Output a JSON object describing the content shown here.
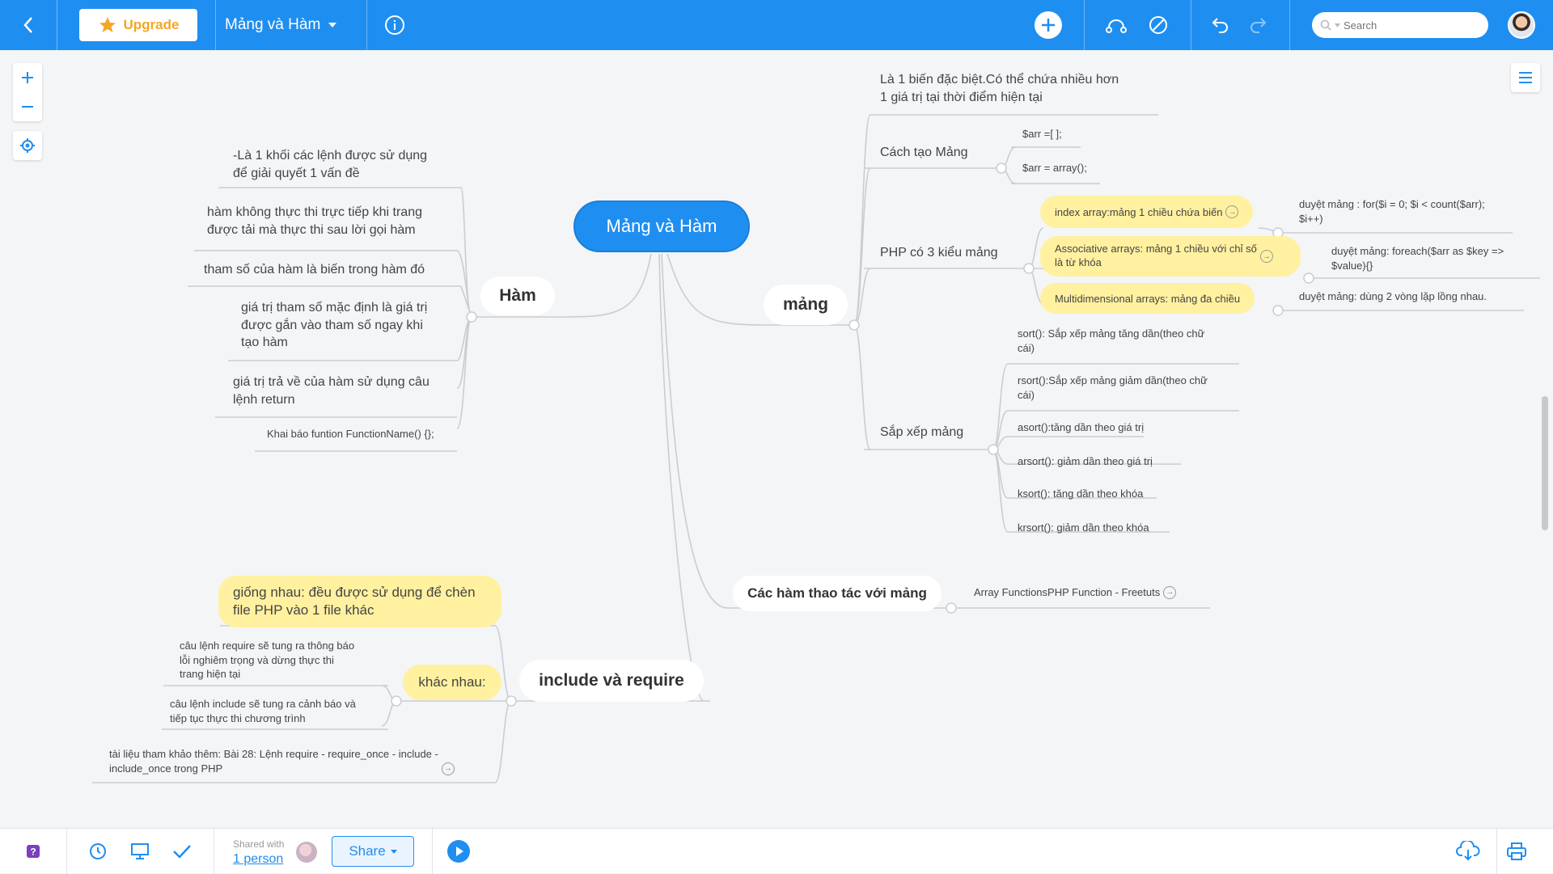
{
  "topbar": {
    "upgrade_label": "Upgrade",
    "title": "Mảng và Hàm",
    "search_placeholder": "Search"
  },
  "bottombar": {
    "shared_with_label": "Shared with",
    "shared_with_count": "1 person",
    "share_label": "Share"
  },
  "mindmap": {
    "root": "Mảng và Hàm",
    "ham": {
      "label": "Hàm",
      "items": [
        "-Là 1 khối các lệnh được sử dụng\nđể giải quyết 1 vấn đề",
        "hàm không thực thi trực tiếp khi trang\nđược tải mà thực thi sau lời gọi hàm",
        "tham số của hàm là biến trong hàm đó",
        "giá trị tham số mặc định là giá trị\nđược gắn vào tham số ngay khi\ntạo hàm",
        "giá trị trả về của hàm sử dụng câu\nlệnh return",
        "Khai báo funtion FunctionName() {};"
      ]
    },
    "mang": {
      "label": "mảng",
      "definition": "Là 1 biến đặc biệt.Có thể chứa nhiều hơn\n1 giá trị tại thời điểm hiện tại",
      "cach_tao": {
        "label": "Cách tạo Mảng",
        "items": [
          "$arr =[ ];",
          "$arr = array();"
        ]
      },
      "kieu_mang": {
        "label": "PHP có 3 kiểu mảng",
        "types": [
          {
            "label": "index array:mảng 1 chiều chứa biến",
            "note": "duyệt mảng : for($i = 0; $i < count($arr);\n$i++)"
          },
          {
            "label": "Associative arrays: mảng 1 chiều với chỉ số\nlà từ  khóa",
            "note": "duyệt mảng: foreach($arr as $key =>\n$value){}"
          },
          {
            "label": "Multidimensional arrays: mảng đa chiều",
            "note": "duyệt mảng: dùng 2 vòng lặp lồng nhau."
          }
        ]
      },
      "sap_xep": {
        "label": "Sắp xếp mảng",
        "items": [
          "sort(): Sắp xếp mảng tăng dần(theo chữ\ncái)",
          "rsort():Sắp xếp mảng giảm dần(theo chữ\ncái)",
          "asort():tăng dần theo giá trị",
          "arsort(): giảm dần theo giá trị",
          "ksort(): tăng dần theo khóa",
          "krsort(): giảm dần theo khóa"
        ]
      }
    },
    "ham_thao_tac": {
      "label": "Các hàm thao tác với mảng",
      "link": "Array FunctionsPHP Function - Freetuts"
    },
    "include": {
      "label": "include và require",
      "giong_nhau": "giống nhau: đều được sử dụng để chèn\nfile PHP vào 1 file khác",
      "khac_nhau": {
        "label": "khác nhau:",
        "items": [
          "câu lệnh require sẽ tung ra thông báo\nlỗi nghiêm trọng và dừng thực thi\ntrang hiện tại",
          "câu lệnh include sẽ tung ra cảnh báo và\ntiếp tục thực thi chương trình"
        ]
      },
      "tai_lieu": "tài liệu tham khảo thêm: Bài 28: Lệnh require - require_once - include -\ninclude_once trong PHP"
    }
  },
  "colors": {
    "accent": "#1f8ef1",
    "highlight": "#fff1a0",
    "line": "#c9cdd2"
  }
}
